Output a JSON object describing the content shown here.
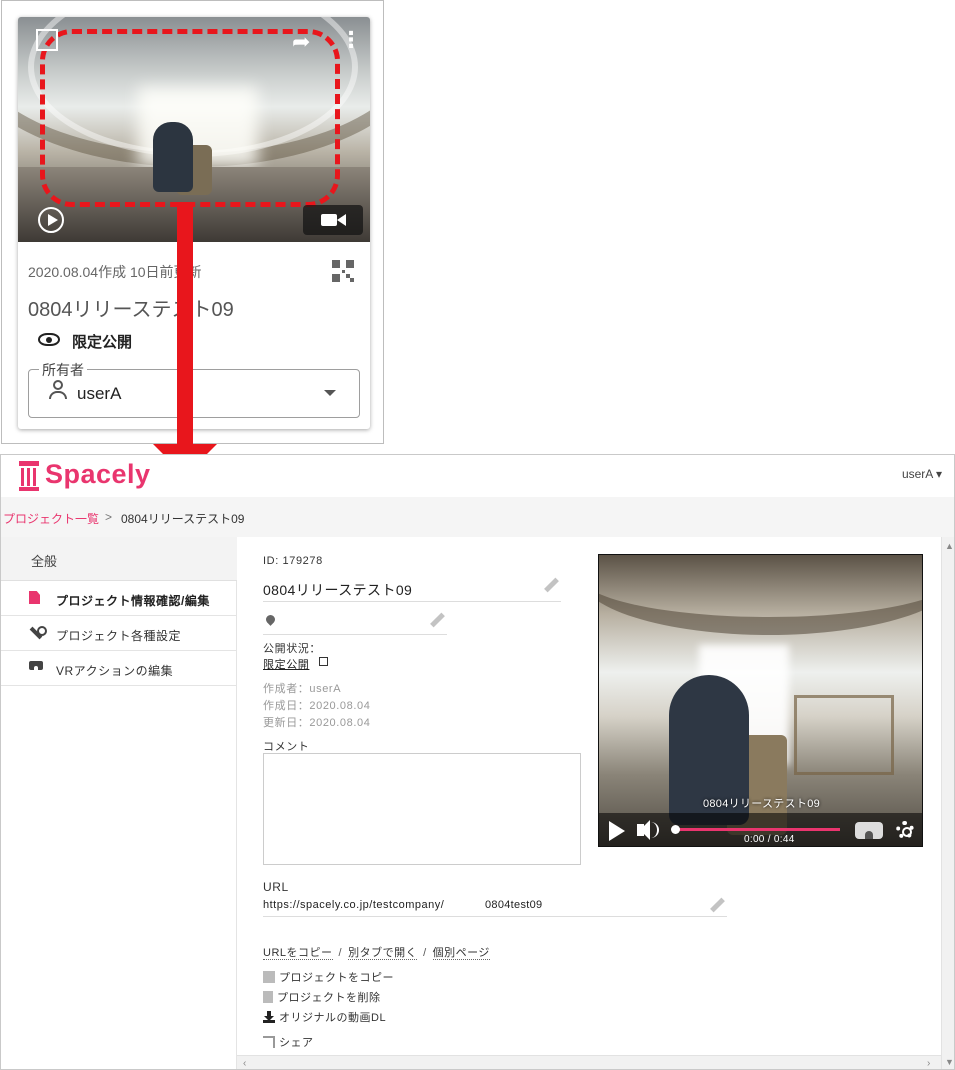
{
  "card": {
    "date_text": "2020.08.04作成 10日前更新",
    "title": "0804リリーステスト09",
    "visibility": "限定公開",
    "owner_legend": "所有者",
    "owner_name": "userA"
  },
  "app": {
    "brand": "Spacely",
    "brand_color": "#e9356e",
    "user_menu": "userA ▾",
    "breadcrumb": {
      "link": "プロジェクト一覧",
      "separator": ">",
      "current": "0804リリーステスト09"
    },
    "sidebar": {
      "header": "全般",
      "items": [
        {
          "label": "プロジェクト情報確認/編集",
          "icon": "document-icon",
          "active": true
        },
        {
          "label": "プロジェクト各種設定",
          "icon": "wrench-icon",
          "active": false
        },
        {
          "label": "VRアクションの編集",
          "icon": "vr-goggles-icon",
          "active": false
        }
      ]
    },
    "project": {
      "id_text": "ID: 179278",
      "name": "0804リリーステスト09",
      "location": "",
      "visibility_label": "公開状況：",
      "visibility_value": "限定公開",
      "creator": "作成者：userA",
      "created": "作成日：2020.08.04",
      "updated": "更新日：2020.08.04",
      "comment_label": "コメント",
      "comment_value": "",
      "url_label": "URL",
      "url_prefix": "https://spacely.co.jp/testcompany/",
      "url_slug": "0804test09"
    },
    "links": {
      "copy_url": "URLをコピー",
      "new_tab": "別タブで開く",
      "individual_page": "個別ページ",
      "separator": "/"
    },
    "actions": {
      "copy_project": "プロジェクトをコピー",
      "delete_project": "プロジェクトを削除",
      "download_original": "オリジナルの動画DL",
      "share": "シェア"
    },
    "player": {
      "title": "0804リリーステスト09",
      "time": "0:00 / 0:44",
      "progress": 0.0
    }
  }
}
